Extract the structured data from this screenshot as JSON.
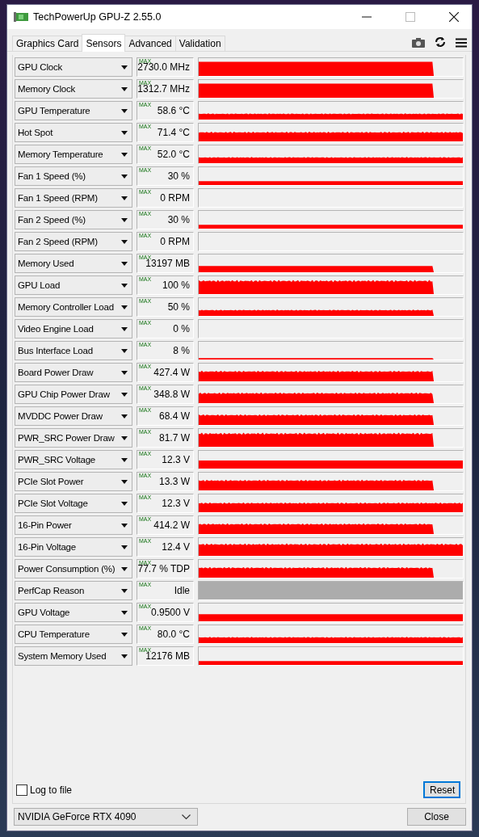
{
  "window": {
    "title": "TechPowerUp GPU-Z 2.55.0"
  },
  "tabs": [
    {
      "label": "Graphics Card",
      "selected": false
    },
    {
      "label": "Sensors",
      "selected": true
    },
    {
      "label": "Advanced",
      "selected": false
    },
    {
      "label": "Validation",
      "selected": false
    }
  ],
  "sensors": [
    {
      "name": "GPU Clock",
      "max_label": "MAX",
      "value": "2730.0 MHz",
      "kind": "block"
    },
    {
      "name": "Memory Clock",
      "max_label": "MAX",
      "value": "1312.7 MHz",
      "kind": "block"
    },
    {
      "name": "GPU Temperature",
      "max_label": "MAX",
      "value": "58.6 °C",
      "kind": "band"
    },
    {
      "name": "Hot Spot",
      "max_label": "MAX",
      "value": "71.4 °C",
      "kind": "hedge"
    },
    {
      "name": "Memory Temperature",
      "max_label": "MAX",
      "value": "52.0 °C",
      "kind": "band"
    },
    {
      "name": "Fan 1 Speed (%)",
      "max_label": "MAX",
      "value": "30 %",
      "kind": "strip"
    },
    {
      "name": "Fan 1 Speed (RPM)",
      "max_label": "MAX",
      "value": "0 RPM",
      "kind": "empty"
    },
    {
      "name": "Fan 2 Speed (%)",
      "max_label": "MAX",
      "value": "30 %",
      "kind": "strip"
    },
    {
      "name": "Fan 2 Speed (RPM)",
      "max_label": "MAX",
      "value": "0 RPM",
      "kind": "empty"
    },
    {
      "name": "Memory Used",
      "max_label": "MAX",
      "value": "13197 MB",
      "kind": "step"
    },
    {
      "name": "GPU Load",
      "max_label": "MAX",
      "value": "100 %",
      "kind": "spiky"
    },
    {
      "name": "Memory Controller Load",
      "max_label": "MAX",
      "value": "50 %",
      "kind": "fringe"
    },
    {
      "name": "Video Engine Load",
      "max_label": "MAX",
      "value": "0 %",
      "kind": "empty"
    },
    {
      "name": "Bus Interface Load",
      "max_label": "MAX",
      "value": "8 %",
      "kind": "trickle"
    },
    {
      "name": "Board Power Draw",
      "max_label": "MAX",
      "value": "427.4 W",
      "kind": "ridge"
    },
    {
      "name": "GPU Chip Power Draw",
      "max_label": "MAX",
      "value": "348.8 W",
      "kind": "ridge"
    },
    {
      "name": "MVDDC Power Draw",
      "max_label": "MAX",
      "value": "68.4 W",
      "kind": "ridge"
    },
    {
      "name": "PWR_SRC Power Draw",
      "max_label": "MAX",
      "value": "81.7 W",
      "kind": "spiky"
    },
    {
      "name": "PWR_SRC Voltage",
      "max_label": "MAX",
      "value": "12.3 V",
      "kind": "plateau"
    },
    {
      "name": "PCIe Slot Power",
      "max_label": "MAX",
      "value": "13.3 W",
      "kind": "ridge"
    },
    {
      "name": "PCIe Slot Voltage",
      "max_label": "MAX",
      "value": "12.3 V",
      "kind": "hedge"
    },
    {
      "name": "16-Pin Power",
      "max_label": "MAX",
      "value": "414.2 W",
      "kind": "ridge"
    },
    {
      "name": "16-Pin Voltage",
      "max_label": "MAX",
      "value": "12.4 V",
      "kind": "wall"
    },
    {
      "name": "Power Consumption (%)",
      "max_label": "MAX",
      "value": "77.7 % TDP",
      "kind": "ridge"
    },
    {
      "name": "PerfCap Reason",
      "max_label": "MAX",
      "value": "Idle",
      "kind": "idle"
    },
    {
      "name": "GPU Voltage",
      "max_label": "MAX",
      "value": "0.9500 V",
      "kind": "shelf"
    },
    {
      "name": "CPU Temperature",
      "max_label": "MAX",
      "value": "80.0 °C",
      "kind": "band"
    },
    {
      "name": "System Memory Used",
      "max_label": "MAX",
      "value": "12176 MB",
      "kind": "strip"
    }
  ],
  "log_to_file": {
    "label": "Log to file",
    "checked": false
  },
  "reset_button": {
    "label": "Reset",
    "focused": true
  },
  "gpu_select": {
    "value": "NVIDIA GeForce RTX 4090"
  },
  "close_button": {
    "label": "Close"
  }
}
